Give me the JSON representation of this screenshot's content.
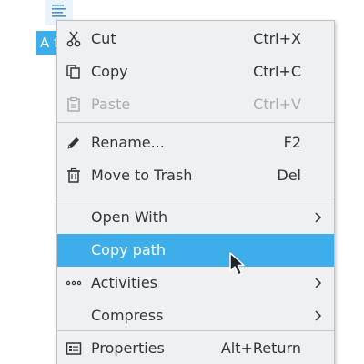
{
  "desktop": {
    "file_icon": "text-document-icon",
    "file_label": "A f"
  },
  "menu": {
    "items": [
      {
        "label": "Cut",
        "shortcut": "Ctrl+X",
        "icon": "scissors-icon"
      },
      {
        "label": "Copy",
        "shortcut": "Ctrl+C",
        "icon": "copy-icon"
      },
      {
        "label": "Paste",
        "shortcut": "Ctrl+V",
        "icon": "clipboard-icon",
        "disabled": true
      },
      {
        "label": "Rename...",
        "shortcut": "F2",
        "icon": "pencil-icon"
      },
      {
        "label": "Move to Trash",
        "shortcut": "Del",
        "icon": "trash-icon"
      },
      {
        "label": "Open With",
        "submenu": true
      },
      {
        "label": "Copy path",
        "highlighted": true
      },
      {
        "label": "Activities",
        "submenu": true,
        "icon": "dots-icon"
      },
      {
        "label": "Compress",
        "submenu": true
      },
      {
        "label": "Properties",
        "shortcut": "Alt+Return",
        "icon": "properties-icon"
      }
    ]
  },
  "colors": {
    "menu_bg": "#eff0f1",
    "highlight": "#3daee9",
    "text": "#31363b",
    "disabled_text": "#a9acaf"
  }
}
